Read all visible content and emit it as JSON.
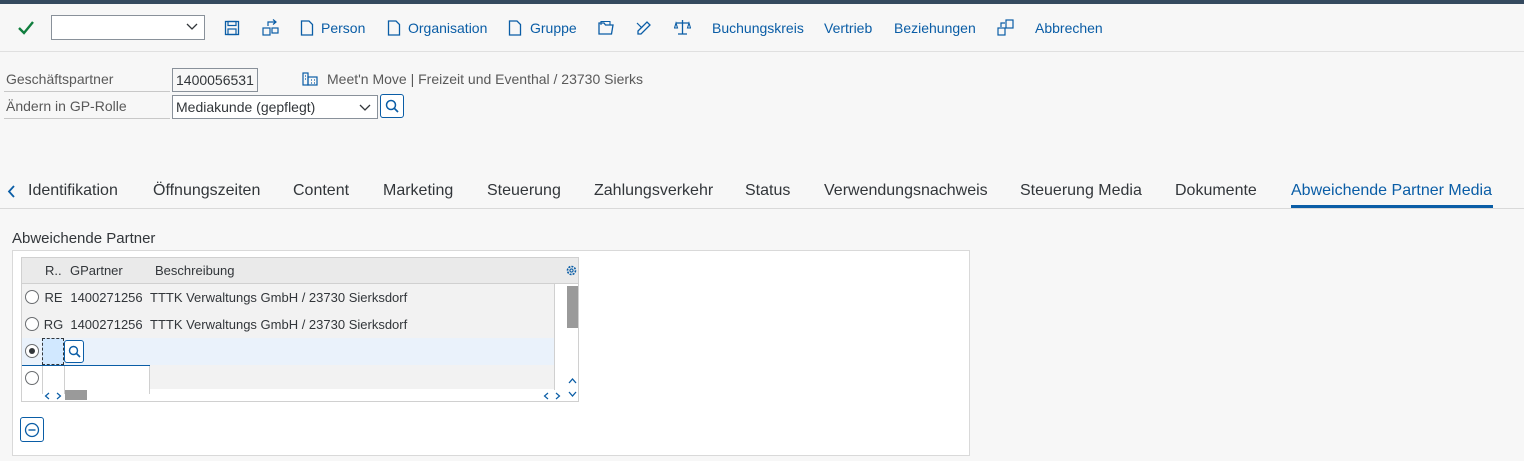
{
  "toolbar": {
    "command_value": "",
    "items": [
      {
        "label": "Person"
      },
      {
        "label": "Organisation"
      },
      {
        "label": "Gruppe"
      },
      {
        "label": "Buchungskreis"
      },
      {
        "label": "Vertrieb"
      },
      {
        "label": "Beziehungen"
      },
      {
        "label": "Abbrechen"
      }
    ]
  },
  "header": {
    "partner_label": "Geschäftspartner",
    "partner_value": "1400056531",
    "partner_desc": "Meet'n Move | Freizeit und Eventhal / 23730 Sierks",
    "role_label": "Ändern in GP-Rolle",
    "role_value": "Mediakunde (gepflegt)"
  },
  "tabs": [
    {
      "label": "Identifikation"
    },
    {
      "label": "Öffnungszeiten"
    },
    {
      "label": "Content"
    },
    {
      "label": "Marketing"
    },
    {
      "label": "Steuerung"
    },
    {
      "label": "Zahlungsverkehr"
    },
    {
      "label": "Status"
    },
    {
      "label": "Verwendungsnachweis"
    },
    {
      "label": "Steuerung Media"
    },
    {
      "label": "Dokumente"
    },
    {
      "label": "Abweichende Partner Media"
    }
  ],
  "section": {
    "title": "Abweichende Partner"
  },
  "table": {
    "columns": [
      "R..",
      "GPartner",
      "Beschreibung"
    ],
    "rows": [
      {
        "role": "RE",
        "partner": "1400271256",
        "desc": "TTTK Verwaltungs GmbH / 23730 Sierksdorf"
      },
      {
        "role": "RG",
        "partner": "1400271256",
        "desc": "TTTK Verwaltungs GmbH / 23730 Sierksdorf"
      },
      {
        "role": "",
        "partner": "",
        "desc": ""
      },
      {
        "role": "",
        "partner": "",
        "desc": ""
      }
    ]
  },
  "colors": {
    "accent": "#0a5da6",
    "check": "#107e3e"
  }
}
